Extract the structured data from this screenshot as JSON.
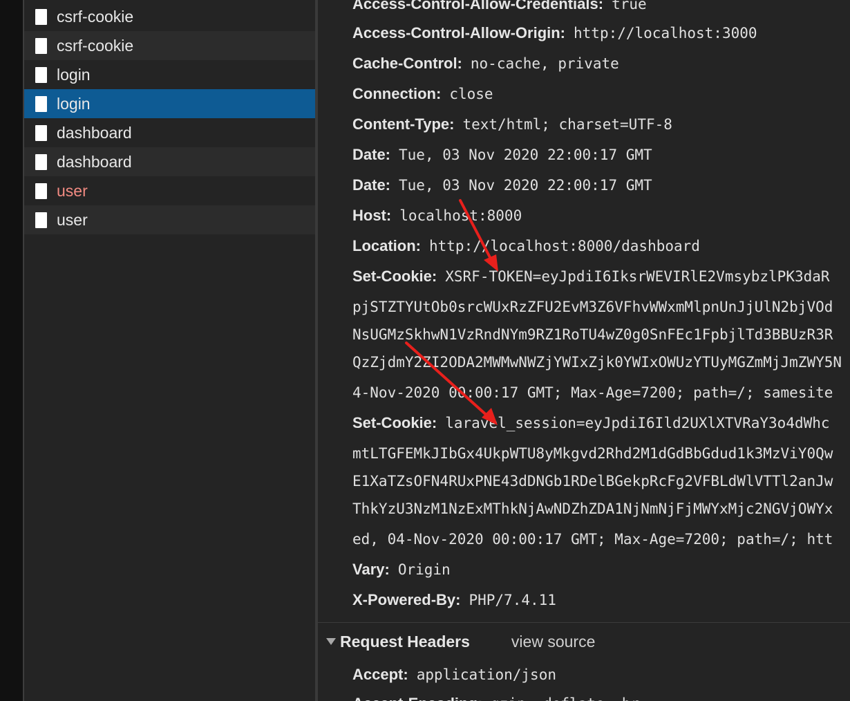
{
  "requests": [
    {
      "name": "csrf-cookie"
    },
    {
      "name": "csrf-cookie"
    },
    {
      "name": "login"
    },
    {
      "name": "login"
    },
    {
      "name": "dashboard"
    },
    {
      "name": "dashboard"
    },
    {
      "name": "user"
    },
    {
      "name": "user"
    }
  ],
  "response_headers": {
    "h0": {
      "key": "Access-Control-Allow-Credentials:",
      "value": "true"
    },
    "h1": {
      "key": "Access-Control-Allow-Origin:",
      "value": "http://localhost:3000"
    },
    "h2": {
      "key": "Cache-Control:",
      "value": "no-cache, private"
    },
    "h3": {
      "key": "Connection:",
      "value": "close"
    },
    "h4": {
      "key": "Content-Type:",
      "value": "text/html; charset=UTF-8"
    },
    "h5": {
      "key": "Date:",
      "value": "Tue, 03 Nov 2020 22:00:17 GMT"
    },
    "h6": {
      "key": "Date:",
      "value": "Tue, 03 Nov 2020 22:00:17 GMT"
    },
    "h7": {
      "key": "Host:",
      "value": "localhost:8000"
    },
    "h8": {
      "key": "Location:",
      "value": "http://localhost:8000/dashboard"
    },
    "h9": {
      "key": "Set-Cookie:",
      "value": "XSRF-TOKEN=eyJpdiI6IksrWEVIRlE2VmsybzlPK3daR",
      "cont": [
        "pjSTZTYUtOb0srcWUxRzZFU2EvM3Z6VFhvWWxmMlpnUnJjUlN2bjVOd",
        "NsUGMzSkhwN1VzRndNYm9RZ1RoTU4wZ0g0SnFEc1FpbjlTd3BBUzR3R",
        "QzZjdmY2ZI2ODA2MWMwNWZjYWIxZjk0YWIxOWUzYTUyMGZmMjJmZWY5N",
        "4-Nov-2020 00:00:17 GMT; Max-Age=7200; path=/; samesite"
      ]
    },
    "h10": {
      "key": "Set-Cookie:",
      "value": "laravel_session=eyJpdiI6Ild2UXlXTVRaY3o4dWhc",
      "cont": [
        "mtLTGFEMkJIbGx4UkpWTU8yMkgvd2Rhd2M1dGdBbGdud1k3MzViY0Qw",
        "E1XaTZsOFN4RUxPNE43dDNGb1RDelBGekpRcFg2VFBLdWlVTTl2anJw",
        "ThkYzU3NzM1NzExMThkNjAwNDZhZDA1NjNmNjFjMWYxMjc2NGVjOWYx",
        "ed, 04-Nov-2020 00:00:17 GMT; Max-Age=7200; path=/; htt"
      ]
    },
    "h11": {
      "key": "Vary:",
      "value": "Origin"
    },
    "h12": {
      "key": "X-Powered-By:",
      "value": "PHP/7.4.11"
    }
  },
  "request_section": {
    "title": "Request Headers",
    "view_source": "view source"
  },
  "request_headers": {
    "r0": {
      "key": "Accept:",
      "value": "application/json"
    },
    "r1": {
      "key": "Accept-Encoding:",
      "value": "gzip, deflate, br"
    }
  },
  "colors": {
    "selected_row": "#0e5b94",
    "error_text": "#f28b82",
    "arrow": "#e8201c"
  }
}
